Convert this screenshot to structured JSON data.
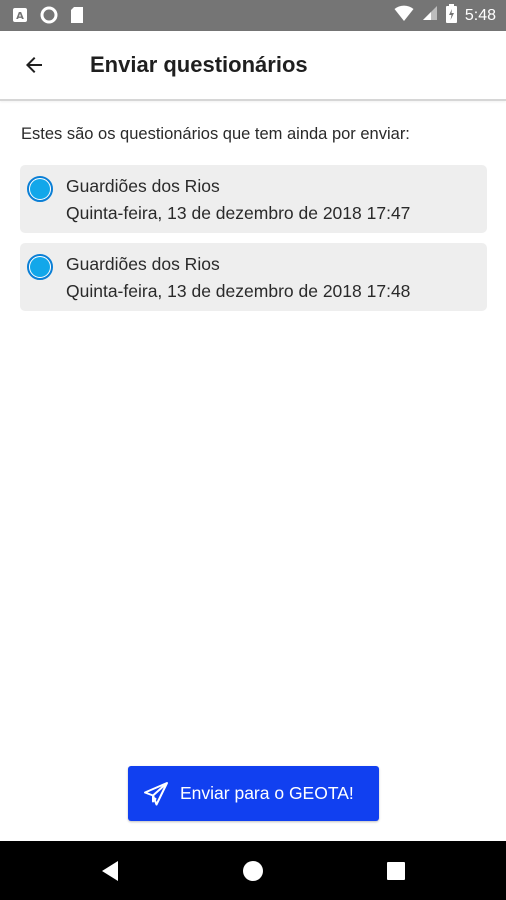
{
  "status_bar": {
    "time": "5:48",
    "left_icons": [
      "app-a-icon",
      "circle-icon",
      "sd-card-icon"
    ],
    "right_icons": [
      "wifi-icon",
      "signal-icon",
      "battery-icon"
    ]
  },
  "app_bar": {
    "back_icon": "arrow-left-icon",
    "title": "Enviar questionários"
  },
  "intro_text": "Estes são os questionários que tem ainda por enviar:",
  "questionnaires": [
    {
      "title": "Guardiões dos Rios",
      "date": "Quinta-feira, 13 de dezembro de 2018 17:47",
      "selected": true
    },
    {
      "title": "Guardiões dos Rios",
      "date": "Quinta-feira, 13 de dezembro de 2018 17:48",
      "selected": true
    }
  ],
  "send_button": {
    "icon": "paper-plane-icon",
    "label": "Enviar para o GEOTA!"
  },
  "nav_bar": {
    "buttons": [
      "back-triangle-icon",
      "home-circle-icon",
      "recents-square-icon"
    ]
  },
  "colors": {
    "status_bar": "#757575",
    "accent_blue": "#1140f0",
    "radio_fill": "#12a7ea",
    "card_bg": "#eeeeee"
  }
}
